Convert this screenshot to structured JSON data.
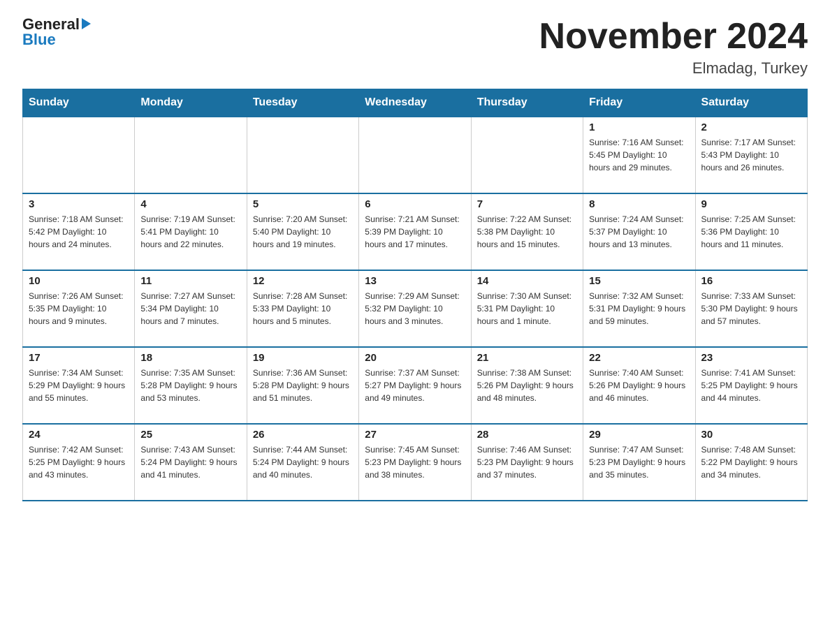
{
  "header": {
    "logo_general": "General",
    "logo_blue": "Blue",
    "title": "November 2024",
    "subtitle": "Elmadag, Turkey"
  },
  "days_of_week": [
    "Sunday",
    "Monday",
    "Tuesday",
    "Wednesday",
    "Thursday",
    "Friday",
    "Saturday"
  ],
  "weeks": [
    [
      {
        "day": "",
        "info": ""
      },
      {
        "day": "",
        "info": ""
      },
      {
        "day": "",
        "info": ""
      },
      {
        "day": "",
        "info": ""
      },
      {
        "day": "",
        "info": ""
      },
      {
        "day": "1",
        "info": "Sunrise: 7:16 AM\nSunset: 5:45 PM\nDaylight: 10 hours and 29 minutes."
      },
      {
        "day": "2",
        "info": "Sunrise: 7:17 AM\nSunset: 5:43 PM\nDaylight: 10 hours and 26 minutes."
      }
    ],
    [
      {
        "day": "3",
        "info": "Sunrise: 7:18 AM\nSunset: 5:42 PM\nDaylight: 10 hours and 24 minutes."
      },
      {
        "day": "4",
        "info": "Sunrise: 7:19 AM\nSunset: 5:41 PM\nDaylight: 10 hours and 22 minutes."
      },
      {
        "day": "5",
        "info": "Sunrise: 7:20 AM\nSunset: 5:40 PM\nDaylight: 10 hours and 19 minutes."
      },
      {
        "day": "6",
        "info": "Sunrise: 7:21 AM\nSunset: 5:39 PM\nDaylight: 10 hours and 17 minutes."
      },
      {
        "day": "7",
        "info": "Sunrise: 7:22 AM\nSunset: 5:38 PM\nDaylight: 10 hours and 15 minutes."
      },
      {
        "day": "8",
        "info": "Sunrise: 7:24 AM\nSunset: 5:37 PM\nDaylight: 10 hours and 13 minutes."
      },
      {
        "day": "9",
        "info": "Sunrise: 7:25 AM\nSunset: 5:36 PM\nDaylight: 10 hours and 11 minutes."
      }
    ],
    [
      {
        "day": "10",
        "info": "Sunrise: 7:26 AM\nSunset: 5:35 PM\nDaylight: 10 hours and 9 minutes."
      },
      {
        "day": "11",
        "info": "Sunrise: 7:27 AM\nSunset: 5:34 PM\nDaylight: 10 hours and 7 minutes."
      },
      {
        "day": "12",
        "info": "Sunrise: 7:28 AM\nSunset: 5:33 PM\nDaylight: 10 hours and 5 minutes."
      },
      {
        "day": "13",
        "info": "Sunrise: 7:29 AM\nSunset: 5:32 PM\nDaylight: 10 hours and 3 minutes."
      },
      {
        "day": "14",
        "info": "Sunrise: 7:30 AM\nSunset: 5:31 PM\nDaylight: 10 hours and 1 minute."
      },
      {
        "day": "15",
        "info": "Sunrise: 7:32 AM\nSunset: 5:31 PM\nDaylight: 9 hours and 59 minutes."
      },
      {
        "day": "16",
        "info": "Sunrise: 7:33 AM\nSunset: 5:30 PM\nDaylight: 9 hours and 57 minutes."
      }
    ],
    [
      {
        "day": "17",
        "info": "Sunrise: 7:34 AM\nSunset: 5:29 PM\nDaylight: 9 hours and 55 minutes."
      },
      {
        "day": "18",
        "info": "Sunrise: 7:35 AM\nSunset: 5:28 PM\nDaylight: 9 hours and 53 minutes."
      },
      {
        "day": "19",
        "info": "Sunrise: 7:36 AM\nSunset: 5:28 PM\nDaylight: 9 hours and 51 minutes."
      },
      {
        "day": "20",
        "info": "Sunrise: 7:37 AM\nSunset: 5:27 PM\nDaylight: 9 hours and 49 minutes."
      },
      {
        "day": "21",
        "info": "Sunrise: 7:38 AM\nSunset: 5:26 PM\nDaylight: 9 hours and 48 minutes."
      },
      {
        "day": "22",
        "info": "Sunrise: 7:40 AM\nSunset: 5:26 PM\nDaylight: 9 hours and 46 minutes."
      },
      {
        "day": "23",
        "info": "Sunrise: 7:41 AM\nSunset: 5:25 PM\nDaylight: 9 hours and 44 minutes."
      }
    ],
    [
      {
        "day": "24",
        "info": "Sunrise: 7:42 AM\nSunset: 5:25 PM\nDaylight: 9 hours and 43 minutes."
      },
      {
        "day": "25",
        "info": "Sunrise: 7:43 AM\nSunset: 5:24 PM\nDaylight: 9 hours and 41 minutes."
      },
      {
        "day": "26",
        "info": "Sunrise: 7:44 AM\nSunset: 5:24 PM\nDaylight: 9 hours and 40 minutes."
      },
      {
        "day": "27",
        "info": "Sunrise: 7:45 AM\nSunset: 5:23 PM\nDaylight: 9 hours and 38 minutes."
      },
      {
        "day": "28",
        "info": "Sunrise: 7:46 AM\nSunset: 5:23 PM\nDaylight: 9 hours and 37 minutes."
      },
      {
        "day": "29",
        "info": "Sunrise: 7:47 AM\nSunset: 5:23 PM\nDaylight: 9 hours and 35 minutes."
      },
      {
        "day": "30",
        "info": "Sunrise: 7:48 AM\nSunset: 5:22 PM\nDaylight: 9 hours and 34 minutes."
      }
    ]
  ]
}
